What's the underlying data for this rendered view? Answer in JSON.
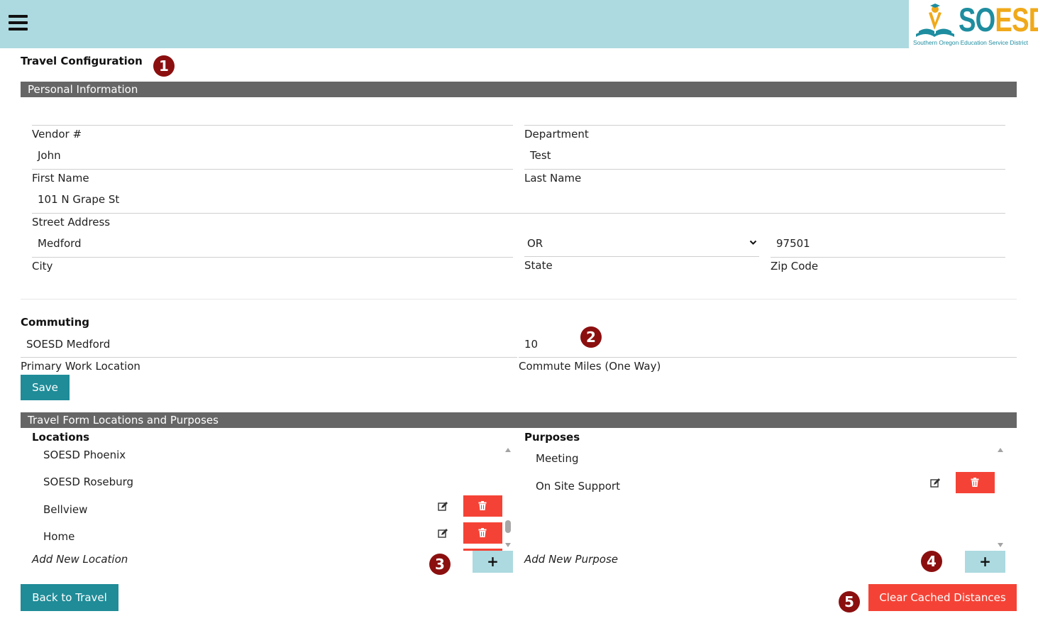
{
  "header": {
    "menu_icon": "hamburger-menu-icon",
    "logo": {
      "word_so": "SO",
      "word_esd": "ESD",
      "tagline": "Southern Oregon Education Service District"
    }
  },
  "annotations": [
    "1",
    "2",
    "3",
    "4",
    "5"
  ],
  "page_title": "Travel Configuration",
  "personal_info": {
    "section_title": "Personal Information",
    "vendor_label": "Vendor #",
    "vendor_value": "",
    "department_label": "Department",
    "department_value": "",
    "first_name_value": "John",
    "first_name_label": "First Name",
    "last_name_value": "Test",
    "last_name_label": "Last Name",
    "street_value": "101 N Grape St",
    "street_label": "Street Address",
    "city_value": "Medford",
    "city_label": "City",
    "state_value": "OR",
    "state_label": "State",
    "zip_value": "97501",
    "zip_label": "Zip Code"
  },
  "commuting": {
    "title": "Commuting",
    "work_location_value": "SOESD Medford",
    "work_location_label": "Primary Work Location",
    "commute_miles_value": "10",
    "commute_miles_label": "Commute Miles (One Way)",
    "save_label": "Save"
  },
  "locations_purposes": {
    "section_title": "Travel Form Locations and Purposes",
    "locations_title": "Locations",
    "locations": [
      "SOESD Phoenix",
      "SOESD Roseburg",
      "Bellview",
      "Home"
    ],
    "add_location_placeholder": "Add New Location",
    "purposes_title": "Purposes",
    "purposes": [
      "Meeting",
      "On Site Support"
    ],
    "add_purpose_placeholder": "Add New Purpose",
    "add_label": "+"
  },
  "footer": {
    "back_label": "Back to Travel",
    "clear_label": "Clear Cached Distances"
  },
  "colors": {
    "header_bg": "#acdae0",
    "section_bar": "#666666",
    "teal_button": "#1f8c98",
    "red_button": "#f44336",
    "marker": "#8b0f0f"
  }
}
